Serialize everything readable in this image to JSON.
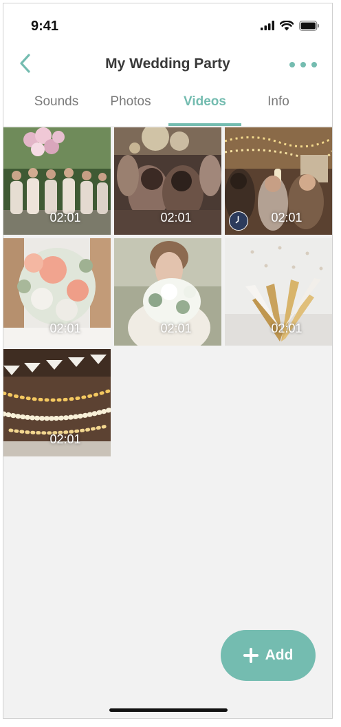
{
  "status_bar": {
    "time": "9:41",
    "icons": [
      "signal-icon",
      "wifi-icon",
      "battery-icon"
    ]
  },
  "nav": {
    "title": "My Wedding Party",
    "back_icon": "chevron-left-icon",
    "more_icon": "more-dots-icon"
  },
  "tabs": [
    {
      "label": "Sounds",
      "active": false
    },
    {
      "label": "Photos",
      "active": false
    },
    {
      "label": "Videos",
      "active": true
    },
    {
      "label": "Info",
      "active": false
    }
  ],
  "videos": [
    {
      "duration": "02:01",
      "subject": "bridesmaids with balloons"
    },
    {
      "duration": "02:01",
      "subject": "couple with sparklers"
    },
    {
      "duration": "02:01",
      "subject": "toast with champagne",
      "badge": "clock-icon"
    },
    {
      "duration": "02:01",
      "subject": "bridal bouquet"
    },
    {
      "duration": "02:01",
      "subject": "bride with flowers"
    },
    {
      "duration": "02:01",
      "subject": "gold party decoration"
    },
    {
      "duration": "02:01",
      "subject": "string lights and bunting"
    }
  ],
  "add_button": {
    "label": "Add",
    "icon": "plus-icon"
  },
  "colors": {
    "accent": "#74bcb0",
    "title_text": "#3a3a3a",
    "inactive_tab": "#7a7a7a",
    "background": "#f2f2f2"
  }
}
